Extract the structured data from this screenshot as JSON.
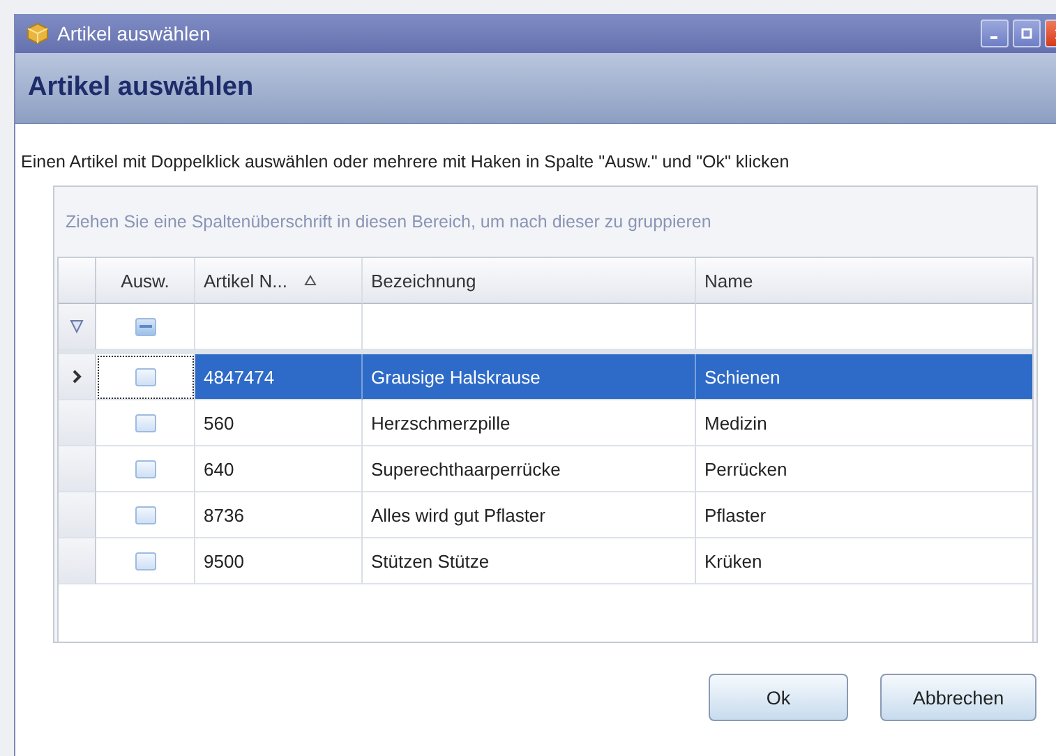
{
  "window": {
    "title": "Artikel auswählen"
  },
  "header": "Artikel auswählen",
  "instruction": "Einen Artikel mit Doppelklick auswählen oder mehrere mit Haken in Spalte \"Ausw.\" und \"Ok\" klicken",
  "group_panel": "Ziehen Sie eine Spaltenüberschrift in diesen Bereich, um nach dieser zu gruppieren",
  "table": {
    "columns": [
      {
        "label": "Ausw.",
        "sorted": false
      },
      {
        "label": "Artikel N...",
        "sorted": true
      },
      {
        "label": "Bezeichnung",
        "sorted": false
      },
      {
        "label": "Name",
        "sorted": false
      }
    ],
    "filter_row": {
      "checkbox_indeterminate": true
    },
    "rows": [
      {
        "checked": false,
        "selected": true,
        "number": "4847474",
        "bezeichnung": "Grausige Halskrause",
        "name": "Schienen"
      },
      {
        "checked": false,
        "selected": false,
        "number": "560",
        "bezeichnung": "Herzschmerzpille",
        "name": "Medizin"
      },
      {
        "checked": false,
        "selected": false,
        "number": "640",
        "bezeichnung": "Superechthaarperrücke",
        "name": "Perrücken"
      },
      {
        "checked": false,
        "selected": false,
        "number": "8736",
        "bezeichnung": "Alles wird gut Pflaster",
        "name": "Pflaster"
      },
      {
        "checked": false,
        "selected": false,
        "number": "9500",
        "bezeichnung": "Stützen Stütze",
        "name": "Krüken"
      }
    ]
  },
  "buttons": [
    "Ok",
    "Abbrechen"
  ]
}
